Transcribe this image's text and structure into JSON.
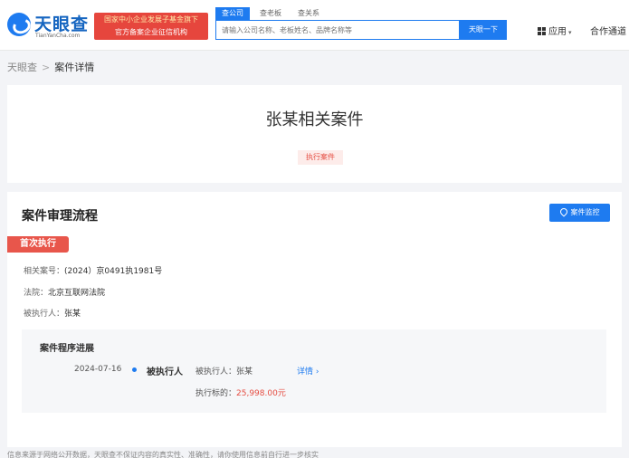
{
  "header": {
    "logo_text": "天眼查",
    "logo_sub": "TianYanCha.com",
    "banner_line1": "国家中小企业发展子基金旗下",
    "banner_line2": "官方备案企业征信机构",
    "search_tabs": [
      "查公司",
      "查老板",
      "查关系"
    ],
    "search_placeholder": "请输入公司名称、老板姓名、品牌名称等",
    "search_button": "天眼一下",
    "apps_label": "应用",
    "partner_label": "合作通道"
  },
  "breadcrumb": {
    "home": "天眼查",
    "separator": ">",
    "current": "案件详情"
  },
  "title_card": {
    "title": "张某相关案件",
    "tag": "执行案件"
  },
  "process": {
    "section_title": "案件审理流程",
    "monitor_button": "案件监控",
    "stage_badge": "首次执行",
    "case_no_label": "相关案号：",
    "case_no": "(2024）京0491执1981号",
    "court_label": "法院：",
    "court": "北京互联网法院",
    "executed_label": "被执行人：",
    "executed": "张某",
    "sub_panel": {
      "title": "案件程序进展",
      "date": "2024-07-16",
      "role": "被执行人",
      "party_label": "被执行人：",
      "party": "张某",
      "detail_link": "详情",
      "amount_label": "执行标的：",
      "amount": "25,998.00元"
    }
  },
  "footer_note": "信息来源于网络公开数据，天眼查不保证内容的真实性、准确性，请你使用信息前自行进一步核实",
  "colors": {
    "brand_blue": "#1e7bf0",
    "accent_red": "#e54d42",
    "page_bg": "#f3f4f7"
  }
}
